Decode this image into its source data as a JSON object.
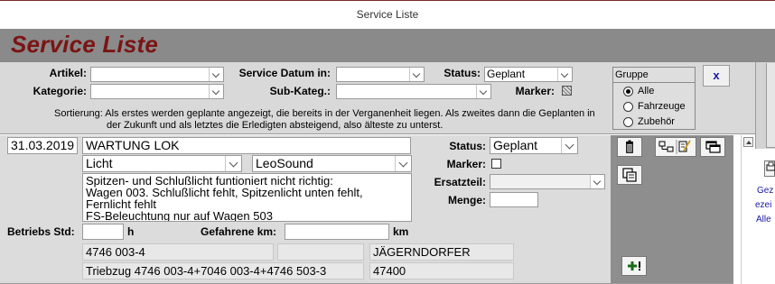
{
  "window": {
    "title": "Service Liste"
  },
  "form": {
    "title": "Service Liste"
  },
  "filters": {
    "artikel_label": "Artikel:",
    "artikel_value": "",
    "kategorie_label": "Kategorie:",
    "kategorie_value": "",
    "service_datum_label": "Service Datum in:",
    "service_datum_value": "",
    "sub_kateg_label": "Sub-Kateg.:",
    "sub_kateg_value": "",
    "status_label": "Status:",
    "status_value": "Geplant",
    "marker_label": "Marker:",
    "close_label": "x"
  },
  "sort_note": {
    "label": "Sortierung:",
    "line1": "Als erstes werden geplante angezeigt, die bereits in der Verganenheit liegen. Als zweites dann die Geplanten in",
    "line2": "der Zukunft und als letztes die Erledigten absteigend, also älteste zu unterst."
  },
  "gruppe": {
    "title": "Gruppe",
    "options": [
      {
        "label": "Alle",
        "selected": true
      },
      {
        "label": "Fahrzeuge",
        "selected": false
      },
      {
        "label": "Zubehör",
        "selected": false
      }
    ]
  },
  "record": {
    "date": "31.03.2019",
    "title": "WARTUNG LOK",
    "kategorie": "Licht",
    "sub_kategorie": "LeoSound",
    "description_lines": [
      "Spitzen- und Schlußlicht funtioniert nicht richtig:",
      "Wagen 003. Schlußlicht fehlt, Spitzenlicht unten fehlt,",
      "Fernlicht fehlt",
      "FS-Beleuchtung nur auf Wagen 503"
    ],
    "status_label": "Status:",
    "status_value": "Geplant",
    "marker_label": "Marker:",
    "ersatzteil_label": "Ersatzteil:",
    "ersatzteil_value": "",
    "menge_label": "Menge:",
    "menge_value": "",
    "betriebs_label": "Betriebs Std:",
    "betriebs_value": "",
    "betriebs_unit": "h",
    "gefahrene_label": "Gefahrene km:",
    "gefahrene_value": "",
    "gefahrene_unit": "km",
    "article_number": "4746 003-4",
    "extra_field": "",
    "manufacturer": "JÄGERNDORFER",
    "article_name": "Triebzug 4746 003-4+7046 003-4+4746 503-3",
    "article_code": "47400"
  },
  "side_links": [
    "Gez",
    "ezei",
    "Alle"
  ],
  "colors": {
    "title_red": "#7b1414",
    "header_gray": "#8a8a8a",
    "filter_gray": "#d9d9d9",
    "link_blue": "#1a1aa0"
  }
}
